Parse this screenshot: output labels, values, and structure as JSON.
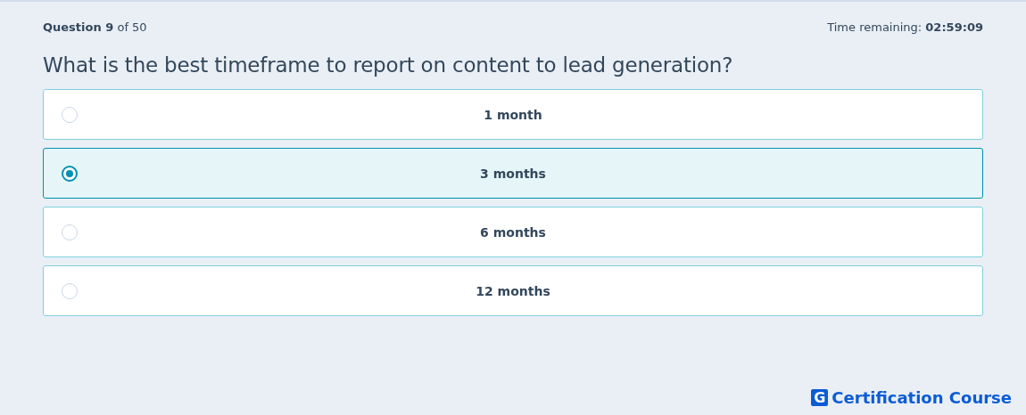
{
  "header": {
    "question_label": "Question",
    "question_number": "9",
    "question_of": "of 50",
    "time_label": "Time remaining:",
    "time_value": "02:59:09"
  },
  "question": "What is the best timeframe to report on content to lead generation?",
  "options": [
    {
      "label": "1 month",
      "selected": false
    },
    {
      "label": "3 months",
      "selected": true
    },
    {
      "label": "6 months",
      "selected": false
    },
    {
      "label": "12 months",
      "selected": false
    }
  ],
  "logo": {
    "mark": "G",
    "text": "Certification Course"
  }
}
